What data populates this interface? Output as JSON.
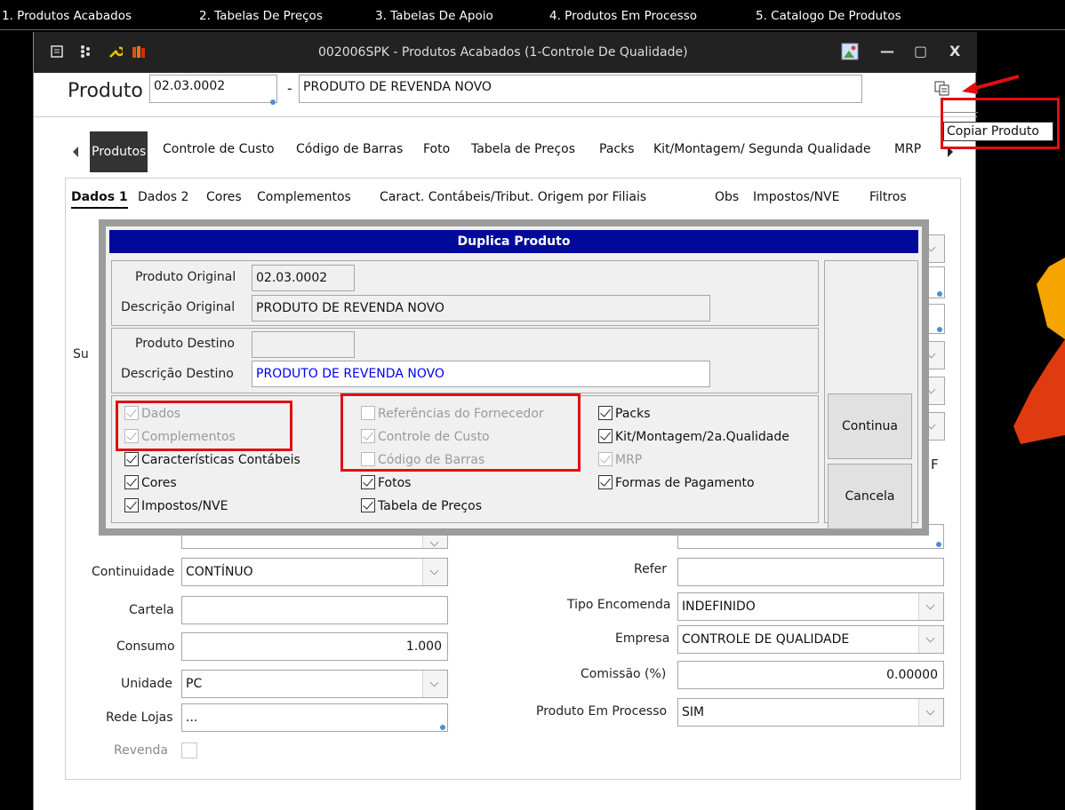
{
  "top_menu": [
    "1. Produtos Acabados",
    "2. Tabelas De Preços",
    "3. Tabelas De Apoio",
    "4. Produtos Em Processo",
    "5. Catalogo De Produtos"
  ],
  "window": {
    "title": "002006SPK - Produtos Acabados (1-Controle De Qualidade)",
    "min": "—",
    "max": "▢",
    "close": "X"
  },
  "produto": {
    "label": "Produto",
    "code": "02.03.0002",
    "dash": "-",
    "description": "PRODUTO DE REVENDA NOVO"
  },
  "tooltip": "Copiar Produto",
  "tabs": [
    "Produtos",
    "Controle de Custo",
    "Código de Barras",
    "Foto",
    "Tabela de Preços",
    "Packs",
    "Kit/Montagem/ Segunda Qualidade",
    "MRP"
  ],
  "subtabs": [
    "Dados 1",
    "Dados 2",
    "Cores",
    "Complementos",
    "Caract. Contábeis/Tribut. Origem por Filiais",
    "Obs",
    "Impostos/NVE",
    "Filtros"
  ],
  "form": {
    "partial_left_label": "Su",
    "partial_right_label": "F",
    "continuidade": {
      "label": "Continuidade",
      "value": "CONTÍNUO"
    },
    "cartela": {
      "label": "Cartela",
      "value": ""
    },
    "consumo": {
      "label": "Consumo",
      "value": "1.000"
    },
    "unidade": {
      "label": "Unidade",
      "value": "PC"
    },
    "rede_lojas": {
      "label": "Rede Lojas",
      "value": "..."
    },
    "revenda": {
      "label": "Revenda"
    },
    "refer": {
      "label": "Refer",
      "value": ""
    },
    "tipo_encomenda": {
      "label": "Tipo Encomenda",
      "value": "INDEFINIDO"
    },
    "empresa": {
      "label": "Empresa",
      "value": "CONTROLE DE QUALIDADE"
    },
    "comissao": {
      "label": "Comissão (%)",
      "value": "0.00000"
    },
    "produto_em_processo": {
      "label": "Produto Em Processo",
      "value": "SIM"
    }
  },
  "dialog": {
    "title": "Duplica Produto",
    "produto_original_label": "Produto Original",
    "produto_original": "02.03.0002",
    "descricao_original_label": "Descrição  Original",
    "descricao_original": "PRODUTO DE REVENDA NOVO",
    "produto_destino_label": "Produto Destino",
    "produto_destino": "",
    "descricao_destino_label": "Descrição  Destino",
    "descricao_destino": "PRODUTO DE REVENDA NOVO",
    "continua": "Continua",
    "cancela": "Cancela",
    "checks": {
      "dados": "Dados",
      "complementos": "Complementos",
      "caracteristicas": "Características Contábeis",
      "cores": "Cores",
      "impostos": "Impostos/NVE",
      "referencias": "Referências do Fornecedor",
      "controle_custo": "Controle de Custo",
      "codigo_barras": "Código de Barras",
      "fotos": "Fotos",
      "tabela_precos": "Tabela de Preços",
      "packs": "Packs",
      "kit": "Kit/Montagem/2a.Qualidade",
      "mrp": "MRP",
      "formas_pagamento": "Formas de Pagamento"
    }
  },
  "colors": {
    "highlight": "#e01010",
    "dialog_title": "#000a9a",
    "destino_text": "#0000ee"
  }
}
